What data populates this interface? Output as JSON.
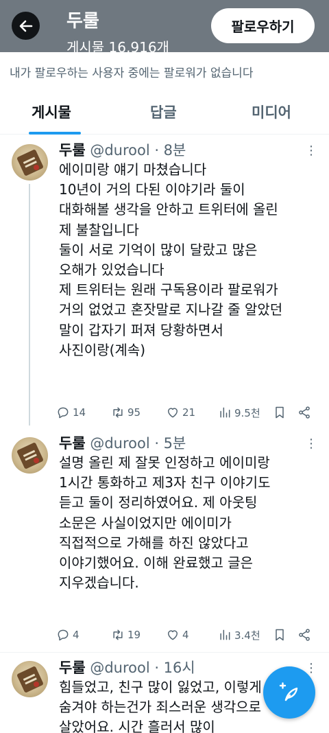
{
  "header": {
    "name": "두룰",
    "subtitle": "게시물 16,916개",
    "follow_label": "팔로우하기",
    "back_icon": "arrow-left-icon"
  },
  "followers_note": "내가 팔로우하는 사용자 중에는 팔로워가 없습니다",
  "tabs": [
    {
      "label": "게시물",
      "active": true
    },
    {
      "label": "답글",
      "active": false
    },
    {
      "label": "미디어",
      "active": false
    }
  ],
  "posts": [
    {
      "name": "두룰",
      "meta": " @durool · 8분",
      "lines": [
        "에이미랑 얘기 마쳤습니다",
        "10년이 거의 다된 이야기라 둘이",
        "대화해볼 생각을 안하고 트위터에 올린",
        "제 불찰입니다",
        "둘이 서로 기억이 많이 달랐고 많은",
        "오해가 있었습니다",
        "제 트위터는 원래 구독용이라 팔로워가",
        "거의 없었고 혼잣말로 지나갈 줄 알았던",
        "말이 갑자기 퍼져 당황하면서",
        "사진이랑(계속)"
      ],
      "replies": "14",
      "reposts": "95",
      "likes": "21",
      "views": "9.5천"
    },
    {
      "name": "두룰",
      "meta": " @durool · 5분",
      "lines": [
        "설명 올린 제 잘못 인정하고 에이미랑",
        "1시간 통화하고 제3자 친구 이야기도",
        "듣고 둘이 정리하였어요. 제 아웃팅",
        "소문은 사실이었지만 에이미가",
        "직접적으로 가해를 하진 않았다고",
        "이야기했어요. 이해 완료했고 글은",
        "지우겠습니다."
      ],
      "replies": "4",
      "reposts": "19",
      "likes": "4",
      "views": "3.4천"
    },
    {
      "name": "두룰",
      "meta": " @durool · 16시",
      "lines": [
        "힘들었고, 친구 많이 잃었고, 이렇게",
        "숨겨야 하는건가 죄스러운 생각으로",
        "살았어요. 시간 흘러서 많이"
      ]
    }
  ],
  "colors": {
    "accent": "#1d9bf0",
    "header_bg": "#6f7880",
    "muted": "#536471"
  }
}
